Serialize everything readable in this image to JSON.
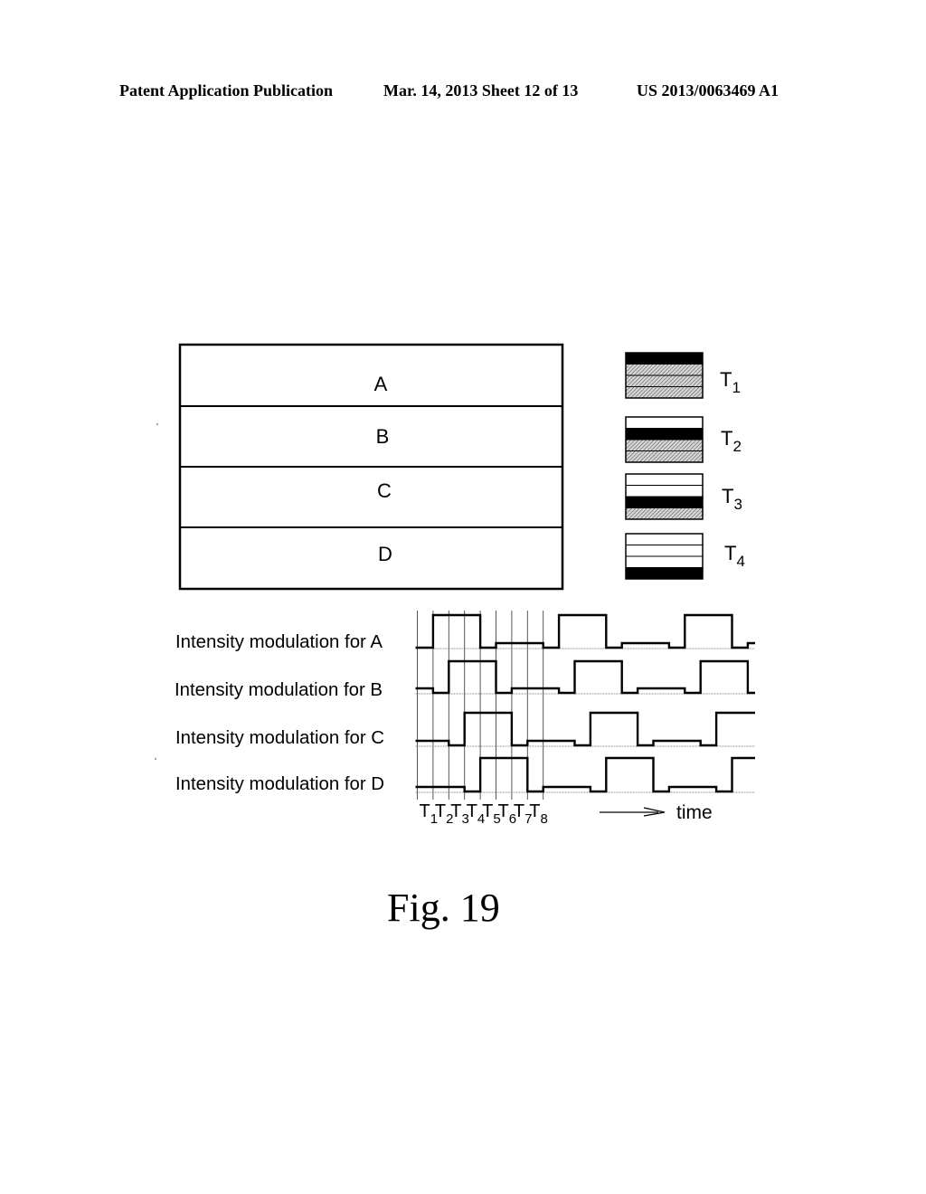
{
  "header": {
    "left": "Patent Application Publication",
    "middle": "Mar. 14, 2013  Sheet 12 of 13",
    "right": "US 2013/0063469 A1"
  },
  "figure": {
    "caption": "Fig. 19",
    "regions": [
      {
        "label": "A"
      },
      {
        "label": "B"
      },
      {
        "label": "C"
      },
      {
        "label": "D"
      }
    ],
    "legend": [
      {
        "label": "T",
        "sub": "1",
        "layers": [
          "black",
          "hatch",
          "hatch",
          "hatch"
        ]
      },
      {
        "label": "T",
        "sub": "2",
        "layers": [
          "white",
          "black",
          "hatch",
          "hatch"
        ]
      },
      {
        "label": "T",
        "sub": "3",
        "layers": [
          "white",
          "white",
          "black",
          "hatch"
        ]
      },
      {
        "label": "T",
        "sub": "4",
        "layers": [
          "white",
          "white",
          "white",
          "black"
        ]
      }
    ],
    "timing": {
      "channels": [
        {
          "label": "Intensity modulation for A",
          "phase_slots": 0
        },
        {
          "label": "Intensity modulation for B",
          "phase_slots": 1
        },
        {
          "label": "Intensity modulation for C",
          "phase_slots": 2
        },
        {
          "label": "Intensity modulation for D",
          "phase_slots": 3
        }
      ],
      "pattern": {
        "period_slots": 8,
        "levels_per_slot": [
          "low",
          "high",
          "high",
          "high",
          "low",
          "mid",
          "mid",
          "mid"
        ]
      },
      "slot_labels": [
        {
          "t": "T",
          "sub": "1"
        },
        {
          "t": "T",
          "sub": "2"
        },
        {
          "t": "T",
          "sub": "3"
        },
        {
          "t": "T",
          "sub": "4"
        },
        {
          "t": "T",
          "sub": "5"
        },
        {
          "t": "T",
          "sub": "6"
        },
        {
          "t": "T",
          "sub": "7"
        },
        {
          "t": "T",
          "sub": "8"
        }
      ],
      "time_label": "time"
    }
  }
}
